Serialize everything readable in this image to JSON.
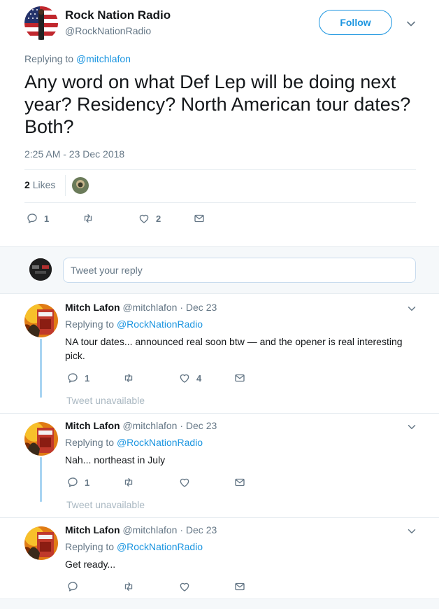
{
  "tweet": {
    "author_name": "Rock Nation Radio",
    "author_handle": "@RockNationRadio",
    "follow_label": "Follow",
    "replying_prefix": "Replying to",
    "replying_to": "@mitchlafon",
    "text": "Any word on what Def Lep will be doing next year? Residency? North American tour dates? Both?",
    "timestamp": "2:25 AM - 23 Dec 2018",
    "likes_count": "2",
    "likes_label": "Likes",
    "actions": {
      "reply_count": "1",
      "retweet_count": "",
      "like_count": "2"
    },
    "icons": [
      "chevron-down-icon",
      "reply-icon",
      "retweet-icon",
      "heart-icon",
      "message-icon"
    ]
  },
  "reply_box": {
    "placeholder": "Tweet your reply"
  },
  "replies": [
    {
      "name": "Mitch Lafon",
      "handle": "@mitchlafon",
      "date": "· Dec 23",
      "replying_prefix": "Replying to",
      "replying_to": "@RockNationRadio",
      "text": "NA tour dates... announced real soon btw — and the opener is real interesting pick.",
      "reply_count": "1",
      "like_count": "4"
    },
    {
      "name": "Mitch Lafon",
      "handle": "@mitchlafon",
      "date": "· Dec 23",
      "replying_prefix": "Replying to",
      "replying_to": "@RockNationRadio",
      "text": "Nah... northeast in July",
      "reply_count": "1",
      "like_count": ""
    },
    {
      "name": "Mitch Lafon",
      "handle": "@mitchlafon",
      "date": "· Dec 23",
      "replying_prefix": "Replying to",
      "replying_to": "@RockNationRadio",
      "text": "Get ready...",
      "reply_count": "",
      "like_count": ""
    }
  ],
  "unavailable_label": "Tweet unavailable",
  "colors": {
    "accent": "#1b95e0",
    "muted": "#657786",
    "thread_line": "#a8d4f2",
    "background_alt": "#f5f8fa"
  }
}
